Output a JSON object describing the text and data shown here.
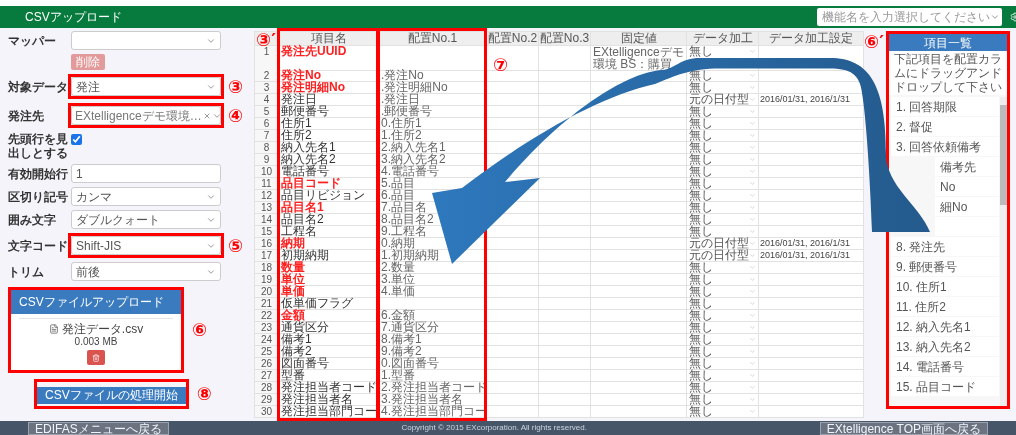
{
  "header": {
    "title": "CSVアップロード",
    "search_placeholder": "機能名を入力選択してください"
  },
  "left_panel": {
    "mapper": {
      "label": "マッパー"
    },
    "delete_button": {
      "label": "削除",
      "disabled": true
    },
    "fields": [
      {
        "kind": "select",
        "label": "対象データ",
        "value": "発注",
        "marker": "③"
      },
      {
        "kind": "multiselect",
        "label": "発注先",
        "value": "EXtelligenceデモ環境…",
        "marker": "④"
      },
      {
        "kind": "checkbox",
        "label": "先頭行を見出しとする",
        "checked": true
      },
      {
        "kind": "text",
        "label": "有効開始行",
        "value": "1"
      },
      {
        "kind": "select",
        "label": "区切り記号",
        "value": "カンマ"
      },
      {
        "kind": "select",
        "label": "囲み文字",
        "value": "ダブルクォート"
      },
      {
        "kind": "select",
        "label": "文字コード",
        "value": "Shift-JIS",
        "marker": "⑤"
      },
      {
        "kind": "select",
        "label": "トリム",
        "value": "前後"
      }
    ],
    "upload": {
      "title": "CSVファイルアップロード",
      "file_name": "発注データ.csv",
      "file_size": "0.003 MB",
      "marker": "⑥"
    },
    "process_button": {
      "label": "CSVファイルの処理開始",
      "marker": "⑧"
    }
  },
  "table": {
    "columns": [
      {
        "label": "項目名",
        "marker": "③′"
      },
      {
        "label": "配置No.1",
        "marker": "⑦"
      },
      {
        "label": "配置No.2"
      },
      {
        "label": "配置No.3"
      },
      {
        "label": "固定値"
      },
      {
        "label": "データ加工"
      },
      {
        "label": "データ加工設定"
      }
    ],
    "rows": [
      {
        "no": "1",
        "name": "発注先UUID",
        "required": true,
        "fixed": "EXtelligenceデモ環境 BS：購買",
        "process": "無し"
      },
      {
        "no": "2",
        "name": "発注No",
        "required": true,
        "mapped": ".発注No",
        "process": "無し"
      },
      {
        "no": "3",
        "name": "発注明細No",
        "required": true,
        "mapped": ".発注明細No",
        "process": "無し"
      },
      {
        "no": "4",
        "name": "発注日",
        "required": false,
        "mapped": ".発注日",
        "process": "元の日付型",
        "setting": "2016/01/31, 2016/1/31"
      },
      {
        "no": "5",
        "name": "郵便番号",
        "required": false,
        "mapped": ".郵便番号",
        "process": "無し"
      },
      {
        "no": "6",
        "name": "住所1",
        "required": false,
        "mapped": "0.住所1",
        "process": "無し"
      },
      {
        "no": "7",
        "name": "住所2",
        "required": false,
        "mapped": "1.住所2",
        "process": "無し"
      },
      {
        "no": "8",
        "name": "納入先名1",
        "required": false,
        "mapped": "2.納入先名1",
        "process": "無し"
      },
      {
        "no": "9",
        "name": "納入先名2",
        "required": false,
        "mapped": "3.納入先名2",
        "process": "無し"
      },
      {
        "no": "10",
        "name": "電話番号",
        "required": false,
        "mapped": "4.電話番号",
        "process": "無し"
      },
      {
        "no": "11",
        "name": "品目コード",
        "required": true,
        "mapped": "5.品目",
        "process": "無し"
      },
      {
        "no": "12",
        "name": "品目リビジョン",
        "required": false,
        "mapped": "6.品目",
        "process": "無し"
      },
      {
        "no": "13",
        "name": "品目名1",
        "required": true,
        "mapped": "7.品目名",
        "process": "無し"
      },
      {
        "no": "14",
        "name": "品目名2",
        "required": false,
        "mapped": "8.品目名2",
        "process": "無し"
      },
      {
        "no": "15",
        "name": "工程名",
        "required": false,
        "mapped": "9.工程名",
        "process": "無し"
      },
      {
        "no": "16",
        "name": "納期",
        "required": true,
        "mapped": "0.納期",
        "process": "元の日付型",
        "setting": "2016/01/31, 2016/1/31"
      },
      {
        "no": "17",
        "name": "初期納期",
        "required": false,
        "mapped": "1.初期納期",
        "process": "元の日付型",
        "setting": "2016/01/31, 2016/1/31"
      },
      {
        "no": "18",
        "name": "数量",
        "required": true,
        "mapped": "2.数量",
        "process": "無し"
      },
      {
        "no": "19",
        "name": "単位",
        "required": true,
        "mapped": "3.単位",
        "process": "無し"
      },
      {
        "no": "20",
        "name": "単価",
        "required": true,
        "mapped": "4.単価",
        "process": "無し"
      },
      {
        "no": "21",
        "name": "仮単価フラグ",
        "required": false,
        "process": "無し"
      },
      {
        "no": "22",
        "name": "金額",
        "required": true,
        "mapped": "6.金額",
        "process": "無し"
      },
      {
        "no": "23",
        "name": "通貨区分",
        "required": false,
        "mapped": "7.通貨区分",
        "process": "無し"
      },
      {
        "no": "24",
        "name": "備考1",
        "required": false,
        "mapped": "8.備考1",
        "process": "無し"
      },
      {
        "no": "25",
        "name": "備考2",
        "required": false,
        "mapped": "9.備考2",
        "process": "無し"
      },
      {
        "no": "26",
        "name": "図面番号",
        "required": false,
        "mapped": "0.図面番号",
        "process": "無し"
      },
      {
        "no": "27",
        "name": "型番",
        "required": false,
        "mapped": "1.型番",
        "process": "無し"
      },
      {
        "no": "28",
        "name": "発注担当者コード",
        "required": false,
        "mapped": "2.発注担当者コード",
        "process": "無し"
      },
      {
        "no": "29",
        "name": "発注担当者名",
        "required": false,
        "mapped": "3.発注担当者名",
        "process": "無し"
      },
      {
        "no": "30",
        "name": "発注担当部門コー",
        "required": false,
        "mapped": "4.発注担当部門コー",
        "process": "無し"
      }
    ]
  },
  "item_panel": {
    "title": "項目一覧",
    "instruction": "下記項目を配置カラムにドラッグアンドドロップして下さい",
    "marker": "⑥′",
    "items": [
      {
        "text": "1. 回答期限",
        "covered": false
      },
      {
        "text": "2. 督促",
        "covered": false
      },
      {
        "text": "3. 回答依頼備考",
        "covered": false
      },
      {
        "text": "備考先",
        "covered": true
      },
      {
        "text": "No",
        "covered": true
      },
      {
        "text": "細No",
        "covered": true
      },
      {
        "covered": true
      },
      {
        "text": "8. 発注先",
        "covered": false
      },
      {
        "text": "9. 郵便番号",
        "covered": false
      },
      {
        "text": "10. 住所1",
        "covered": false
      },
      {
        "text": "11. 住所2",
        "covered": false
      },
      {
        "text": "12. 納入先名1",
        "covered": false
      },
      {
        "text": "13. 納入先名2",
        "covered": false
      },
      {
        "text": "14. 電話番号",
        "covered": false
      },
      {
        "text": "15. 品目コード",
        "covered": false
      }
    ]
  },
  "footer": {
    "back_button": "EDIFASメニューへ戻る",
    "copyright": "Copyright © 2015 EXcorporation. All rights reserved.",
    "top_button": "EXtelligence TOP画面へ戻る"
  }
}
